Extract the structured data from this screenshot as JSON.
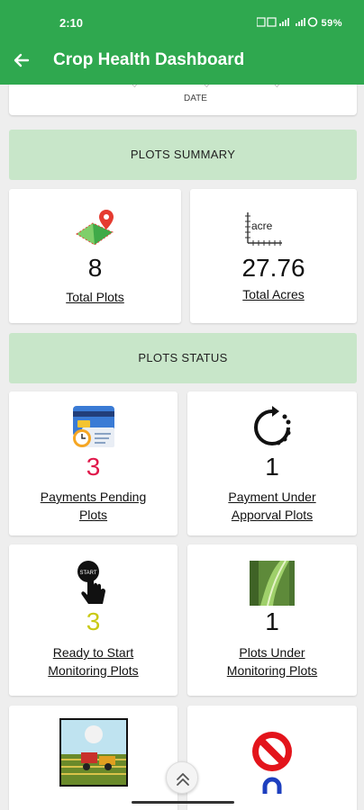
{
  "status_bar": {
    "time": "2:10",
    "icons_text": "VoLTE 59%",
    "battery": "59%"
  },
  "app_bar": {
    "title": "Crop Health Dashboard",
    "back_icon": "arrow-left-icon"
  },
  "chart_partial": {
    "xlabel": "DATE"
  },
  "plots_summary": {
    "header": "PLOTS SUMMARY",
    "total_plots": {
      "value": "8",
      "label": "Total Plots",
      "icon": "map-pin-field-icon"
    },
    "total_acres": {
      "value": "27.76",
      "label": "Total Acres",
      "icon": "acre-ruler-icon",
      "icon_text": "acre"
    }
  },
  "plots_status": {
    "header": "PLOTS STATUS",
    "payments_pending": {
      "value": "3",
      "label_line1": "Payments Pending",
      "label_line2": "Plots",
      "color": "#e0174a",
      "icon": "payment-card-clock-icon"
    },
    "payment_under_approval": {
      "value": "1",
      "label_line1": "Payment Under",
      "label_line2": "Apporval Plots",
      "color": "#111111",
      "icon": "refresh-progress-icon"
    },
    "ready_to_start": {
      "value": "3",
      "label_line1": "Ready to Start",
      "label_line2": "Monitoring Plots",
      "color": "#c9c914",
      "icon": "tap-start-icon",
      "icon_text": "START"
    },
    "plots_under_monitoring": {
      "value": "1",
      "label_line1": "Plots Under",
      "label_line2": "Monitoring Plots",
      "color": "#111111",
      "icon": "leaf-closeup-icon"
    },
    "harvested_card": {
      "icon": "harvester-field-icon"
    },
    "rejected_card": {
      "icon": "prohibited-icon"
    }
  },
  "scroll_top": {
    "icon": "double-chevron-up-icon"
  }
}
